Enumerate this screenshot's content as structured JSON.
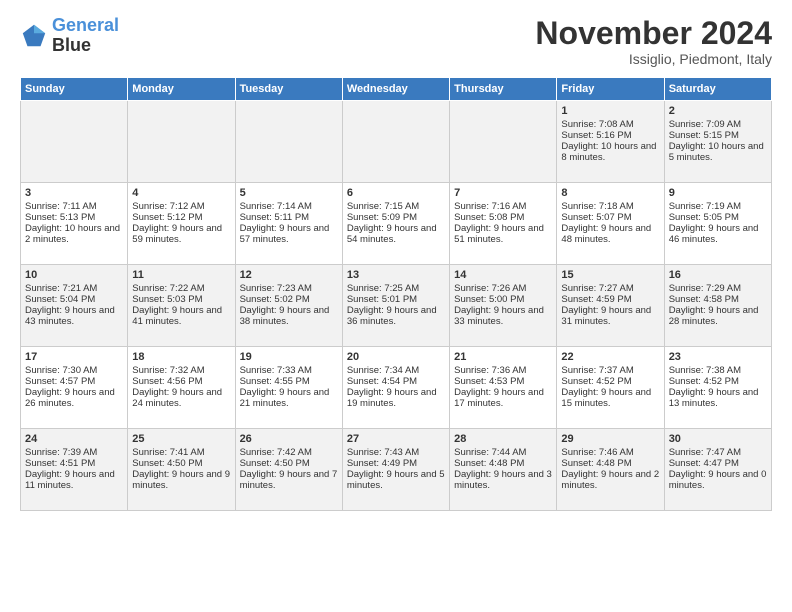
{
  "logo": {
    "line1": "General",
    "line2": "Blue"
  },
  "title": "November 2024",
  "subtitle": "Issiglio, Piedmont, Italy",
  "weekdays": [
    "Sunday",
    "Monday",
    "Tuesday",
    "Wednesday",
    "Thursday",
    "Friday",
    "Saturday"
  ],
  "rows": [
    [
      {
        "day": "",
        "sunrise": "",
        "sunset": "",
        "daylight": ""
      },
      {
        "day": "",
        "sunrise": "",
        "sunset": "",
        "daylight": ""
      },
      {
        "day": "",
        "sunrise": "",
        "sunset": "",
        "daylight": ""
      },
      {
        "day": "",
        "sunrise": "",
        "sunset": "",
        "daylight": ""
      },
      {
        "day": "",
        "sunrise": "",
        "sunset": "",
        "daylight": ""
      },
      {
        "day": "1",
        "sunrise": "Sunrise: 7:08 AM",
        "sunset": "Sunset: 5:16 PM",
        "daylight": "Daylight: 10 hours and 8 minutes."
      },
      {
        "day": "2",
        "sunrise": "Sunrise: 7:09 AM",
        "sunset": "Sunset: 5:15 PM",
        "daylight": "Daylight: 10 hours and 5 minutes."
      }
    ],
    [
      {
        "day": "3",
        "sunrise": "Sunrise: 7:11 AM",
        "sunset": "Sunset: 5:13 PM",
        "daylight": "Daylight: 10 hours and 2 minutes."
      },
      {
        "day": "4",
        "sunrise": "Sunrise: 7:12 AM",
        "sunset": "Sunset: 5:12 PM",
        "daylight": "Daylight: 9 hours and 59 minutes."
      },
      {
        "day": "5",
        "sunrise": "Sunrise: 7:14 AM",
        "sunset": "Sunset: 5:11 PM",
        "daylight": "Daylight: 9 hours and 57 minutes."
      },
      {
        "day": "6",
        "sunrise": "Sunrise: 7:15 AM",
        "sunset": "Sunset: 5:09 PM",
        "daylight": "Daylight: 9 hours and 54 minutes."
      },
      {
        "day": "7",
        "sunrise": "Sunrise: 7:16 AM",
        "sunset": "Sunset: 5:08 PM",
        "daylight": "Daylight: 9 hours and 51 minutes."
      },
      {
        "day": "8",
        "sunrise": "Sunrise: 7:18 AM",
        "sunset": "Sunset: 5:07 PM",
        "daylight": "Daylight: 9 hours and 48 minutes."
      },
      {
        "day": "9",
        "sunrise": "Sunrise: 7:19 AM",
        "sunset": "Sunset: 5:05 PM",
        "daylight": "Daylight: 9 hours and 46 minutes."
      }
    ],
    [
      {
        "day": "10",
        "sunrise": "Sunrise: 7:21 AM",
        "sunset": "Sunset: 5:04 PM",
        "daylight": "Daylight: 9 hours and 43 minutes."
      },
      {
        "day": "11",
        "sunrise": "Sunrise: 7:22 AM",
        "sunset": "Sunset: 5:03 PM",
        "daylight": "Daylight: 9 hours and 41 minutes."
      },
      {
        "day": "12",
        "sunrise": "Sunrise: 7:23 AM",
        "sunset": "Sunset: 5:02 PM",
        "daylight": "Daylight: 9 hours and 38 minutes."
      },
      {
        "day": "13",
        "sunrise": "Sunrise: 7:25 AM",
        "sunset": "Sunset: 5:01 PM",
        "daylight": "Daylight: 9 hours and 36 minutes."
      },
      {
        "day": "14",
        "sunrise": "Sunrise: 7:26 AM",
        "sunset": "Sunset: 5:00 PM",
        "daylight": "Daylight: 9 hours and 33 minutes."
      },
      {
        "day": "15",
        "sunrise": "Sunrise: 7:27 AM",
        "sunset": "Sunset: 4:59 PM",
        "daylight": "Daylight: 9 hours and 31 minutes."
      },
      {
        "day": "16",
        "sunrise": "Sunrise: 7:29 AM",
        "sunset": "Sunset: 4:58 PM",
        "daylight": "Daylight: 9 hours and 28 minutes."
      }
    ],
    [
      {
        "day": "17",
        "sunrise": "Sunrise: 7:30 AM",
        "sunset": "Sunset: 4:57 PM",
        "daylight": "Daylight: 9 hours and 26 minutes."
      },
      {
        "day": "18",
        "sunrise": "Sunrise: 7:32 AM",
        "sunset": "Sunset: 4:56 PM",
        "daylight": "Daylight: 9 hours and 24 minutes."
      },
      {
        "day": "19",
        "sunrise": "Sunrise: 7:33 AM",
        "sunset": "Sunset: 4:55 PM",
        "daylight": "Daylight: 9 hours and 21 minutes."
      },
      {
        "day": "20",
        "sunrise": "Sunrise: 7:34 AM",
        "sunset": "Sunset: 4:54 PM",
        "daylight": "Daylight: 9 hours and 19 minutes."
      },
      {
        "day": "21",
        "sunrise": "Sunrise: 7:36 AM",
        "sunset": "Sunset: 4:53 PM",
        "daylight": "Daylight: 9 hours and 17 minutes."
      },
      {
        "day": "22",
        "sunrise": "Sunrise: 7:37 AM",
        "sunset": "Sunset: 4:52 PM",
        "daylight": "Daylight: 9 hours and 15 minutes."
      },
      {
        "day": "23",
        "sunrise": "Sunrise: 7:38 AM",
        "sunset": "Sunset: 4:52 PM",
        "daylight": "Daylight: 9 hours and 13 minutes."
      }
    ],
    [
      {
        "day": "24",
        "sunrise": "Sunrise: 7:39 AM",
        "sunset": "Sunset: 4:51 PM",
        "daylight": "Daylight: 9 hours and 11 minutes."
      },
      {
        "day": "25",
        "sunrise": "Sunrise: 7:41 AM",
        "sunset": "Sunset: 4:50 PM",
        "daylight": "Daylight: 9 hours and 9 minutes."
      },
      {
        "day": "26",
        "sunrise": "Sunrise: 7:42 AM",
        "sunset": "Sunset: 4:50 PM",
        "daylight": "Daylight: 9 hours and 7 minutes."
      },
      {
        "day": "27",
        "sunrise": "Sunrise: 7:43 AM",
        "sunset": "Sunset: 4:49 PM",
        "daylight": "Daylight: 9 hours and 5 minutes."
      },
      {
        "day": "28",
        "sunrise": "Sunrise: 7:44 AM",
        "sunset": "Sunset: 4:48 PM",
        "daylight": "Daylight: 9 hours and 3 minutes."
      },
      {
        "day": "29",
        "sunrise": "Sunrise: 7:46 AM",
        "sunset": "Sunset: 4:48 PM",
        "daylight": "Daylight: 9 hours and 2 minutes."
      },
      {
        "day": "30",
        "sunrise": "Sunrise: 7:47 AM",
        "sunset": "Sunset: 4:47 PM",
        "daylight": "Daylight: 9 hours and 0 minutes."
      }
    ]
  ]
}
